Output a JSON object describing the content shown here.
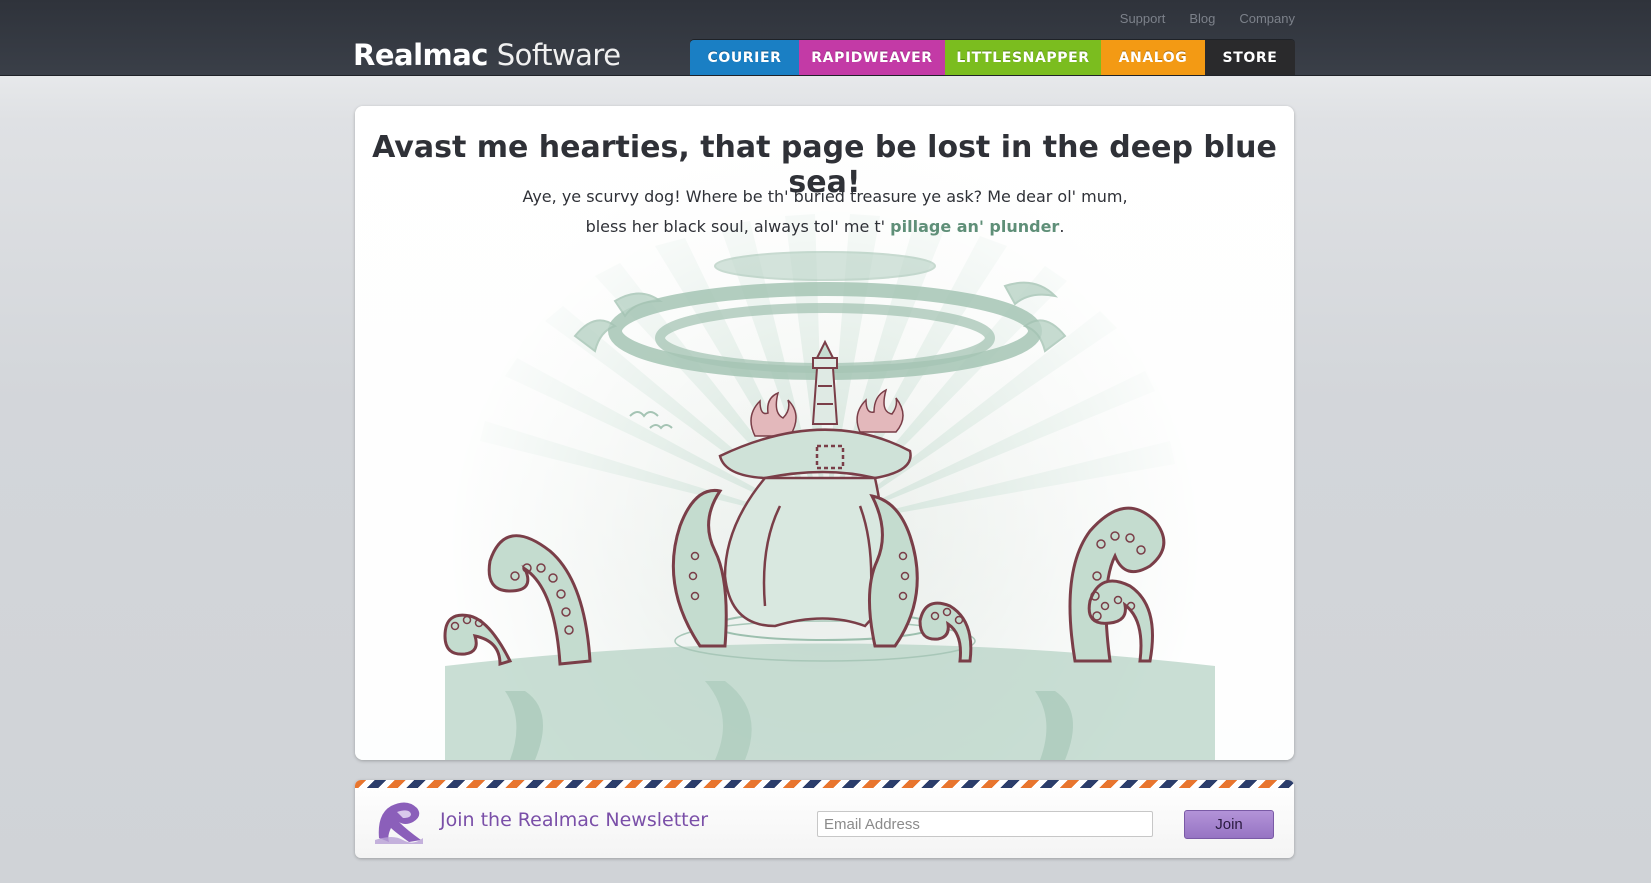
{
  "header": {
    "brand_bold": "Realmac",
    "brand_light": "Software",
    "util_links": [
      "Support",
      "Blog",
      "Company"
    ],
    "nav": [
      {
        "label": "COURIER",
        "color": "#1a7fc4"
      },
      {
        "label": "RAPIDWEAVER",
        "color": "#c33aa6"
      },
      {
        "label": "LITTLESNAPPER",
        "color": "#7bbd1f"
      },
      {
        "label": "ANALOG",
        "color": "#f39a14"
      },
      {
        "label": "STORE",
        "color": "#2a2a2c"
      }
    ]
  },
  "error_page": {
    "headline": "Avast me hearties, that page be lost in the deep blue sea!",
    "intro_text": "Aye, ye scurvy dog! Where be th' buried treasure ye ask? Me dear ol' mum, bless her black soul, always tol' me t' ",
    "intro_link": "pillage an' plunder",
    "intro_end": ".",
    "illustration": "kraken-island-lighthouse"
  },
  "newsletter": {
    "title": "Join the Realmac Newsletter",
    "email_placeholder": "Email Address",
    "join_label": "Join"
  },
  "colors": {
    "accent_link": "#5f8f78",
    "newsletter_purple": "#7a4fa8",
    "tentacle": "#7a3e48",
    "sea_green": "#bcd6c9"
  }
}
